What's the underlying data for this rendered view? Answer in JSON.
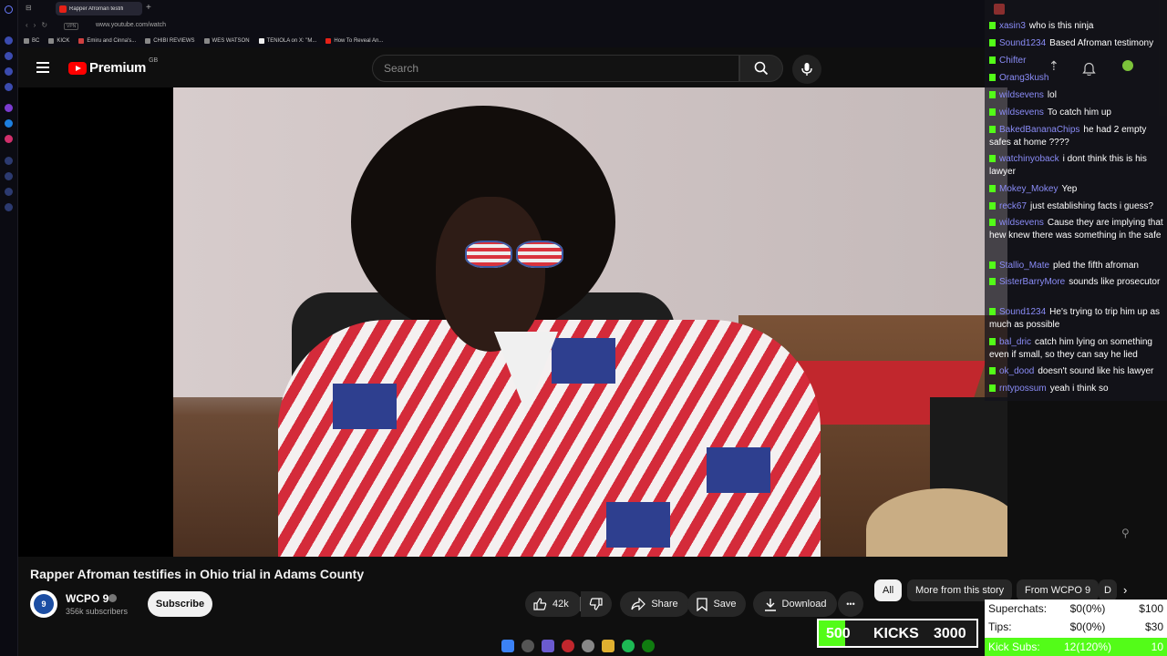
{
  "browser": {
    "tab_title": "Rapper Afroman testifi",
    "url": "www.youtube.com/watch",
    "vpn_label": "VPN",
    "bookmarks": [
      "BC",
      "KICK",
      "Emiru and Cinna's...",
      "CHIBI REVIEWS",
      "WES WATSON",
      "TENIOLA on X: \"M...",
      "How To Reveal An..."
    ]
  },
  "header": {
    "logo_text": "Premium",
    "region": "GB",
    "search_placeholder": "Search"
  },
  "video": {
    "title": "Rapper Afroman testifies in Ohio trial in Adams County"
  },
  "channel": {
    "name": "WCPO 9",
    "subscribers": "356k subscribers",
    "avatar_text": "9"
  },
  "actions": {
    "subscribe": "Subscribe",
    "likes": "42k",
    "share": "Share",
    "save": "Save",
    "download": "Download",
    "more": "•••"
  },
  "chips": {
    "all": "All",
    "more_from_story": "More from this story",
    "from_channel": "From WCPO 9",
    "truncated": "D"
  },
  "chat": {
    "messages": [
      {
        "user": "xasin3",
        "text": "who is this ninja"
      },
      {
        "user": "Sound1234",
        "text": "Based Afroman testimony"
      },
      {
        "user": "Chifter",
        "text": ""
      },
      {
        "user": "Orang3kush",
        "text": ""
      },
      {
        "user": "wildsevens",
        "text": "lol"
      },
      {
        "user": "wildsevens",
        "text": "To catch him up"
      },
      {
        "user": "BakedBananaChips",
        "text": "he had 2 empty safes at home ????"
      },
      {
        "user": "watchinyoback",
        "text": "i dont think this is his lawyer"
      },
      {
        "user": "Mokey_Mokey",
        "text": "Yep"
      },
      {
        "user": "reck67",
        "text": "just establishing facts i guess?"
      },
      {
        "user": "wildsevens",
        "text": "Cause they are implying that hew knew there was something in the safe"
      },
      {
        "user": "Stallio_Mate",
        "text": "pled the fifth afroman"
      },
      {
        "user": "SisterBarryMore",
        "text": "sounds like prosecutor"
      },
      {
        "user": "Sound1234",
        "text": "He's trying to trip him up as much as possible"
      },
      {
        "user": "bal_dric",
        "text": "catch him lying on something even if small, so they can say he lied"
      },
      {
        "user": "ok_dood",
        "text": "doesn't sound like his lawyer"
      },
      {
        "user": "rntypossum",
        "text": "yeah i think so"
      }
    ]
  },
  "stats": {
    "superchats": {
      "label": "Superchats:",
      "value": "$0(0%)",
      "goal": "$100"
    },
    "tips": {
      "label": "Tips:",
      "value": "$0(0%)",
      "goal": "$30"
    },
    "kick_subs": {
      "label": "Kick Subs:",
      "value": "12(120%)",
      "goal": "10"
    }
  },
  "kick_goal": {
    "current": "500",
    "label": "KICKS",
    "target": "3000",
    "progress": 0.17
  },
  "colors": {
    "kick_green": "#53fc18",
    "yt_red": "#ff0000",
    "chat_user": "#8a8cf7"
  }
}
